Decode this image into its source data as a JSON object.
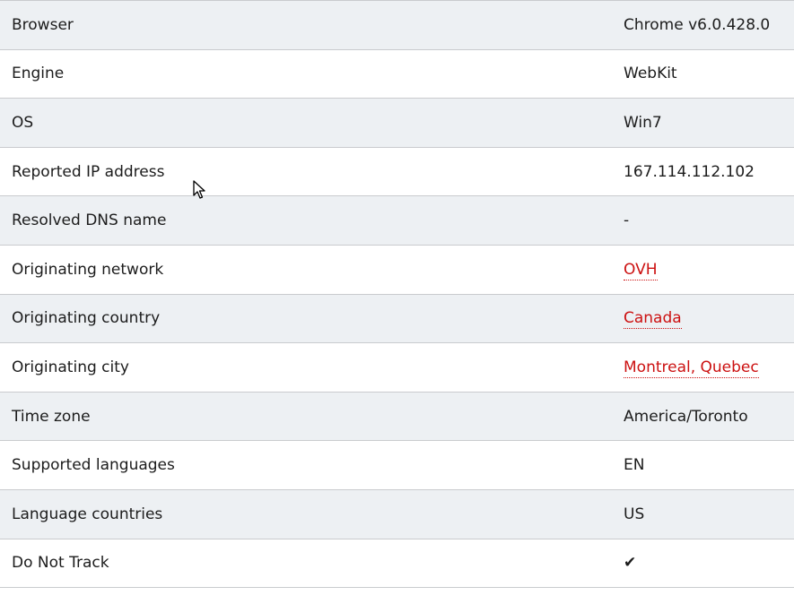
{
  "rows": [
    {
      "label": "Browser",
      "value": "Chrome v6.0.428.0",
      "link": false
    },
    {
      "label": "Engine",
      "value": "WebKit",
      "link": false
    },
    {
      "label": "OS",
      "value": "Win7",
      "link": false
    },
    {
      "label": "Reported IP address",
      "value": "167.114.112.102",
      "link": false
    },
    {
      "label": "Resolved DNS name",
      "value": "-",
      "link": false
    },
    {
      "label": "Originating network",
      "value": "OVH",
      "link": true
    },
    {
      "label": "Originating country",
      "value": "Canada",
      "link": true
    },
    {
      "label": "Originating city",
      "value": "Montreal, Quebec",
      "link": true
    },
    {
      "label": "Time zone",
      "value": "America/Toronto",
      "link": false
    },
    {
      "label": "Supported languages",
      "value": "EN",
      "link": false
    },
    {
      "label": "Language countries",
      "value": "US",
      "link": false
    },
    {
      "label": "Do Not Track",
      "value": "✔",
      "link": false,
      "icon": "checkmark-icon"
    }
  ],
  "colors": {
    "row_alt": "#edf0f3",
    "border": "#c9cbce",
    "link": "#cc1111"
  }
}
